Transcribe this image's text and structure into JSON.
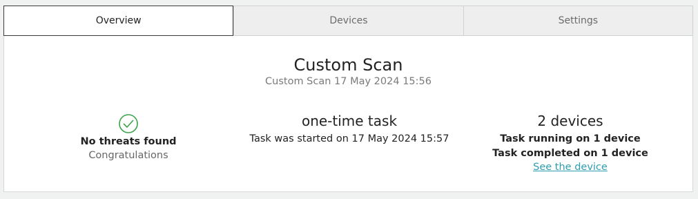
{
  "tabs": [
    {
      "label": "Overview",
      "active": true
    },
    {
      "label": "Devices",
      "active": false
    },
    {
      "label": "Settings",
      "active": false
    }
  ],
  "header": {
    "title": "Custom Scan",
    "subtitle": "Custom Scan 17 May 2024 15:56"
  },
  "status": {
    "icon": "check-circle-icon",
    "icon_color": "#3aa34a",
    "headline": "No threats found",
    "message": "Congratulations"
  },
  "task": {
    "type": "one-time task",
    "started": "Task was started on 17 May 2024 15:57"
  },
  "devices": {
    "count_label": "2 devices",
    "running": "Task running on 1 device",
    "completed": "Task completed on 1 device",
    "link": "See the device",
    "link_color": "#2e9db0"
  }
}
